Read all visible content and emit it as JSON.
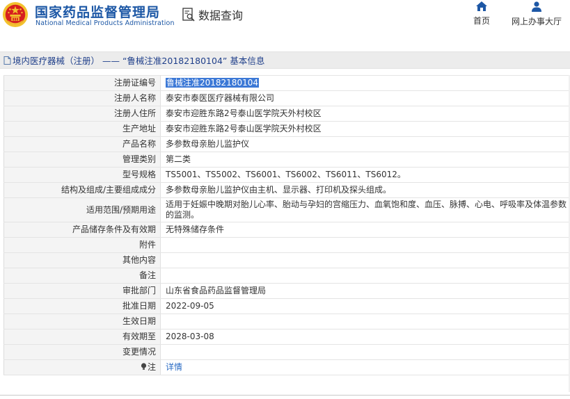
{
  "header": {
    "brand_cn": "国家药品监督管理局",
    "brand_en": "National Medical Products Administration",
    "data_query": "数据查询",
    "nav_home": "首页",
    "nav_online": "网上办事大厅"
  },
  "breadcrumb": "境内医疗器械（注册） —— “鲁械注准20182180104” 基本信息",
  "rows": [
    {
      "label": "注册证编号",
      "value": "鲁械注准20182180104",
      "selected": true
    },
    {
      "label": "注册人名称",
      "value": "泰安市泰医医疗器械有限公司"
    },
    {
      "label": "注册人住所",
      "value": "泰安市迎胜东路2号泰山医学院天外村校区"
    },
    {
      "label": "生产地址",
      "value": "泰安市迎胜东路2号泰山医学院天外村校区"
    },
    {
      "label": "产品名称",
      "value": "多参数母亲胎儿监护仪"
    },
    {
      "label": "管理类别",
      "value": "第二类"
    },
    {
      "label": "型号规格",
      "value": "TS5001、TS5002、TS6001、TS6002、TS6011、TS6012。"
    },
    {
      "label": "结构及组成/主要组成成分",
      "value": "多参数母亲胎儿监护仪由主机、显示器、打印机及探头组成。"
    },
    {
      "label": "适用范围/预期用途",
      "value": "适用于妊娠中晚期对胎儿心率、胎动与孕妇的宫缩压力、血氧饱和度、血压、脉搏、心电、呼吸率及体温参数的监测。",
      "tall": true
    },
    {
      "label": "产品储存条件及有效期",
      "value": "无特殊储存条件"
    },
    {
      "label": "附件",
      "value": ""
    },
    {
      "label": "其他内容",
      "value": ""
    },
    {
      "label": "备注",
      "value": ""
    },
    {
      "label": "审批部门",
      "value": "山东省食品药品监督管理局"
    },
    {
      "label": "批准日期",
      "value": "2022-09-05"
    },
    {
      "label": "生效日期",
      "value": ""
    },
    {
      "label": "有效期至",
      "value": "2028-03-08"
    },
    {
      "label": "变更情况",
      "value": ""
    },
    {
      "label": "注",
      "value": "详情",
      "link": true,
      "icon": "bulb-icon"
    }
  ],
  "colors": {
    "brand": "#1c57a5",
    "breadcrumb_text": "#1f3f8a",
    "link": "#2a6bc4",
    "selection": "#3b78d6",
    "label_bg": "#f4f4f4",
    "emblem_red": "#d61f1f",
    "emblem_gold": "#f2c12e"
  }
}
